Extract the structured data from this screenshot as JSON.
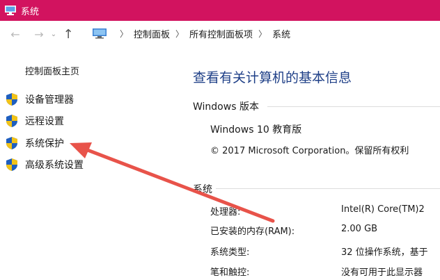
{
  "window": {
    "title": "系统"
  },
  "address": {
    "crumbs": [
      "控制面板",
      "所有控制面板项",
      "系统"
    ]
  },
  "sidebar": {
    "home": "控制面板主页",
    "items": [
      {
        "label": "设备管理器"
      },
      {
        "label": "远程设置"
      },
      {
        "label": "系统保护"
      },
      {
        "label": "高级系统设置"
      }
    ]
  },
  "main": {
    "heading": "查看有关计算机的基本信息",
    "edition_section": "Windows 版本",
    "edition": "Windows 10 教育版",
    "copyright": "© 2017 Microsoft Corporation。保留所有权利",
    "system_section": "系统",
    "rows": [
      {
        "label": "处理器:",
        "value": "Intel(R) Core(TM)2"
      },
      {
        "label": "已安装的内存(RAM):",
        "value": "2.00 GB"
      },
      {
        "label": "系统类型:",
        "value": "32 位操作系统，基于"
      },
      {
        "label": "笔和触控:",
        "value": "没有可用于此显示器"
      }
    ]
  },
  "colors": {
    "titlebar": "#d2135f",
    "heading": "#1e3f87",
    "arrow": "#e8534a"
  },
  "icons": [
    "computer-icon",
    "back-arrow-icon",
    "forward-arrow-icon",
    "chevron-down-icon",
    "up-arrow-icon",
    "shield-icon"
  ]
}
